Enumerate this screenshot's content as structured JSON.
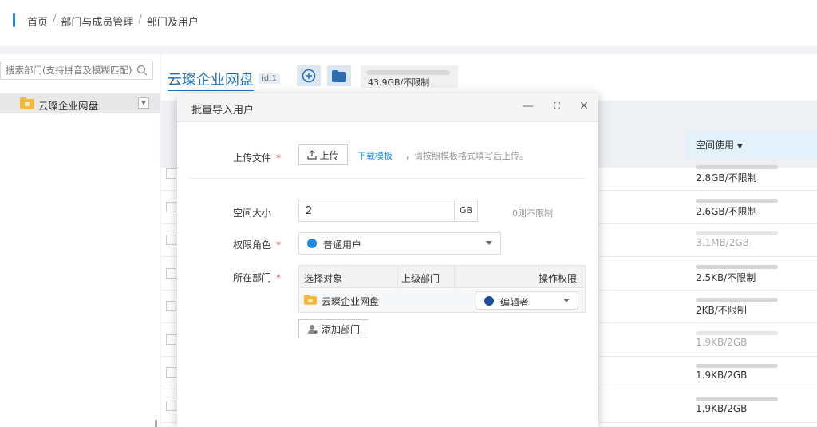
{
  "breadcrumb": [
    "首页",
    "部门与成员管理",
    "部门及用户"
  ],
  "breadcrumb_sep": "/",
  "sidebar": {
    "search_placeholder": "搜索部门(支持拼音及模糊匹配)",
    "tree_item": "云璨企业网盘"
  },
  "main": {
    "title": "云璨企业网盘",
    "id_tag": "id:1",
    "quota": "43.9GB/不限制",
    "column_header": "空间使用",
    "rows": [
      {
        "usage": "2.8GB/不限制",
        "dim": false
      },
      {
        "usage": "2.6GB/不限制",
        "dim": false
      },
      {
        "usage": "3.1MB/2GB",
        "dim": true
      },
      {
        "usage": "2.5KB/不限制",
        "dim": false
      },
      {
        "usage": "2KB/不限制",
        "dim": false
      },
      {
        "usage": "1.9KB/2GB",
        "dim": true
      },
      {
        "usage": "1.9KB/2GB",
        "dim": false
      },
      {
        "usage": "1.9KB/2GB",
        "dim": false
      }
    ]
  },
  "modal": {
    "title": "批量导入用户",
    "upload_label": "上传文件",
    "upload_button": "上传",
    "download_link": "下载模板",
    "download_hint": "，请按照模板格式填写后上传。",
    "size_label": "空间大小",
    "size_value": "2",
    "size_unit": "GB",
    "size_hint": "0则不限制",
    "role_label": "权限角色",
    "role_value": "普通用户",
    "dept_label": "所在部门",
    "dept_table": {
      "headers": [
        "选择对象",
        "上级部门",
        "操作权限"
      ],
      "row_name": "云璨企业网盘",
      "row_permission": "编辑者"
    },
    "add_dept_button": "添加部门",
    "required_mark": "*"
  },
  "colors": {
    "accent": "#1e88e5",
    "role_dot": "#1e88e5",
    "permission_dot": "#1a4f99",
    "folder": "#f5b93a"
  }
}
